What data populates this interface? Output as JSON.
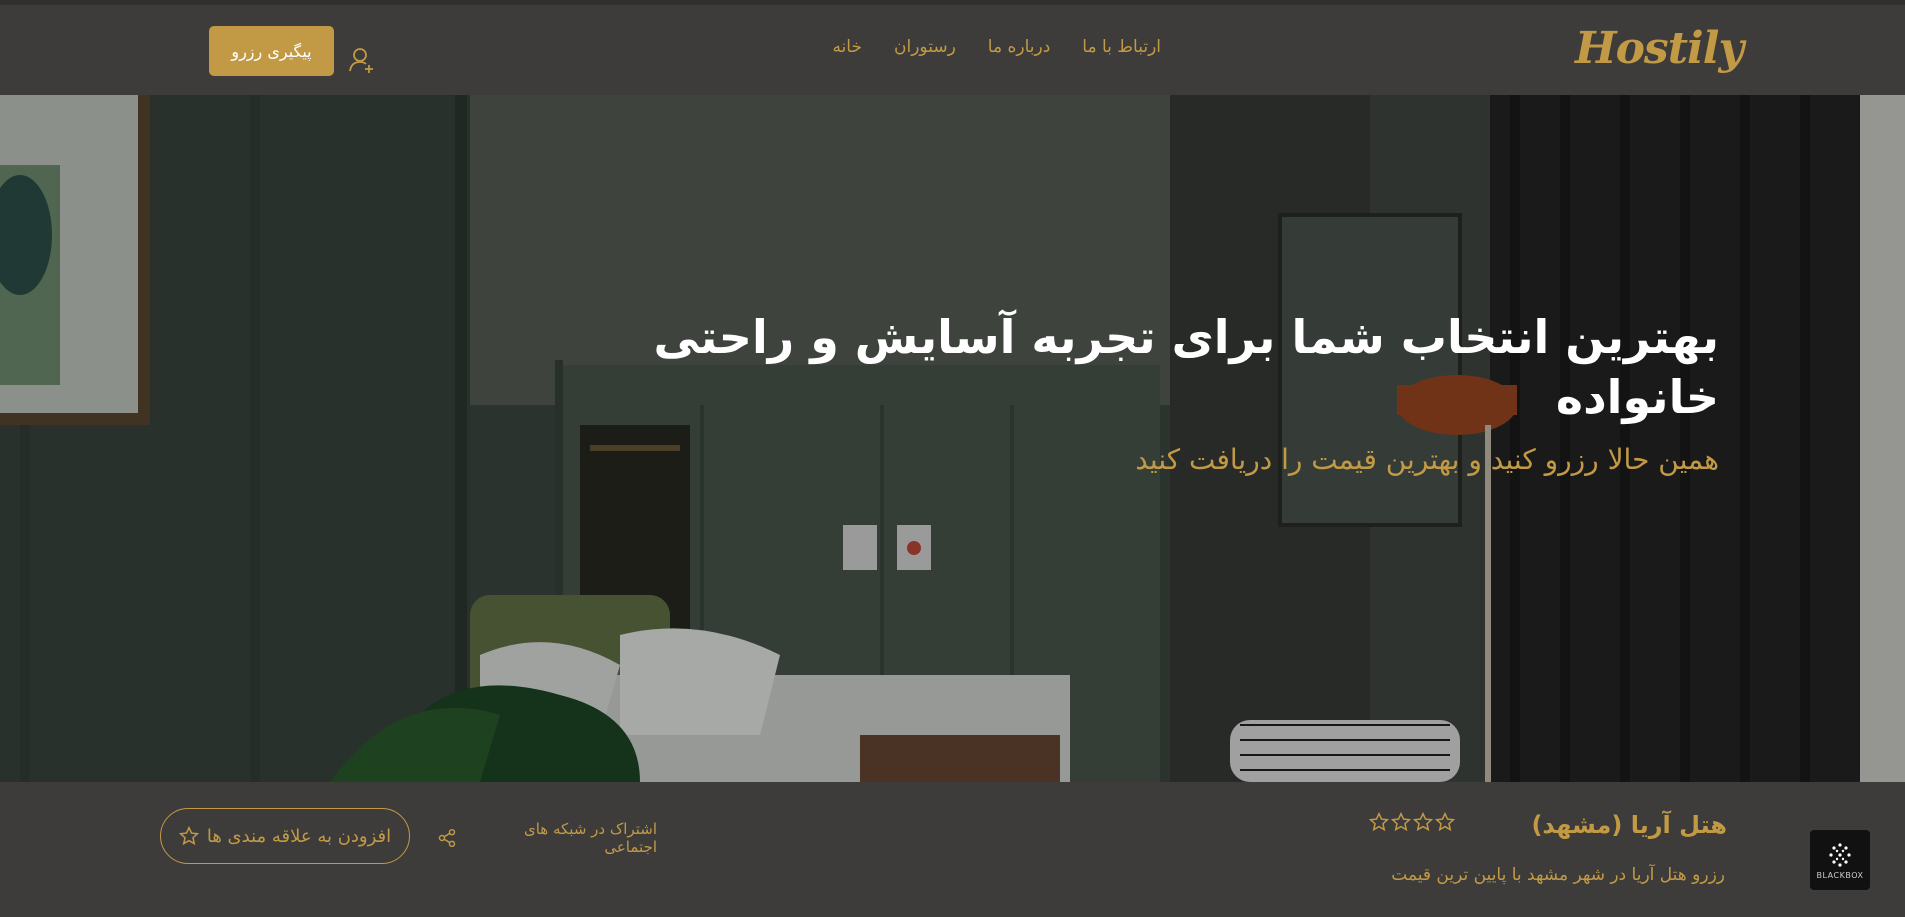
{
  "header": {
    "logo": "Hostily",
    "nav": [
      {
        "label": "خانه"
      },
      {
        "label": "رستوران"
      },
      {
        "label": "درباره ما"
      },
      {
        "label": "ارتباط با ما"
      }
    ],
    "track_button": "پیگیری رزرو",
    "user_icon": "user-plus-icon"
  },
  "hero": {
    "title": "بهترین انتخاب شما برای تجربه آسایش و راحتی خانواده",
    "subtitle": "همین حالا رزرو کنید و بهترین قیمت را دریافت کنید"
  },
  "hotel": {
    "name": "هتل آریا (مشهد)",
    "stars": 4,
    "description": "رزرو هتل آریا در شهر مشهد با پایین ترین قیمت",
    "share_label": "اشتراک در شبکه های اجتماعی",
    "favorite_button": "افزودن به علاقه مندی ها"
  },
  "badge": {
    "label": "BLACKBOX"
  },
  "colors": {
    "accent": "#c29a45",
    "header_bg": "#3d3c3b",
    "text_light": "#ffffff"
  }
}
